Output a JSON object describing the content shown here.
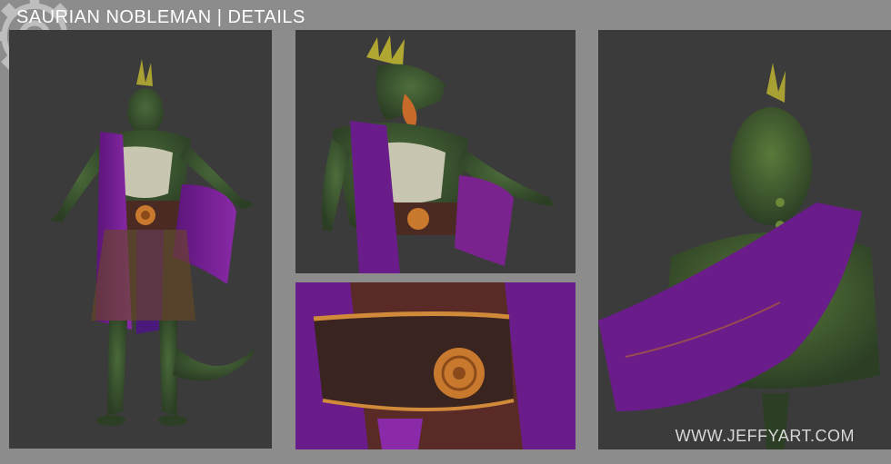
{
  "header": {
    "title": "SAURIAN NOBLEMAN | DETAILS"
  },
  "watermark": {
    "text": "WWW.JEFFYART.COM"
  },
  "panels": [
    {
      "view": "full-body front"
    },
    {
      "view": "upper-body three-quarter"
    },
    {
      "view": "belt buckle close-up"
    },
    {
      "view": "back view"
    }
  ],
  "colors": {
    "background": "#8c8c8c",
    "panel": "#3b3b3b",
    "skin": "#3f5a32",
    "sash": "#6a1d8a",
    "belt": "#4a2a22",
    "gold": "#c8792e"
  }
}
